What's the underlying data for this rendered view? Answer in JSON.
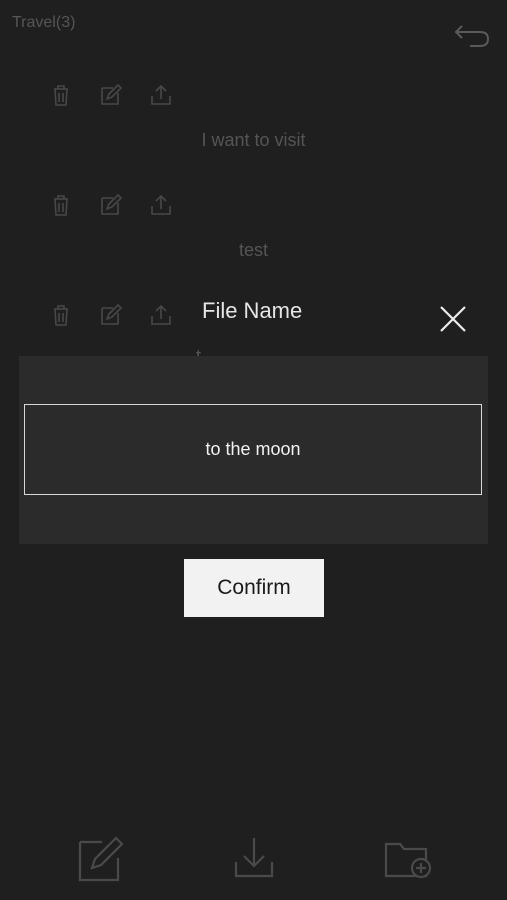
{
  "page": {
    "title": "Travel(3)",
    "icons": {
      "back": "back-arrow-icon",
      "delete": "trash-icon",
      "edit": "edit-icon",
      "share": "share-icon"
    },
    "rows": [
      {
        "text": "I want to visit"
      },
      {
        "text": "test"
      },
      {
        "text": "t..."
      }
    ]
  },
  "dialog": {
    "title": "File Name",
    "close_icon": "close-icon",
    "field_value": "to the moon",
    "confirm_label": "Confirm"
  },
  "toolbar": {
    "icons": [
      "new-note-icon",
      "download-icon",
      "new-folder-icon"
    ]
  },
  "colors": {
    "background": "#1f1f1f",
    "panel": "#2b2b2b",
    "button": "#f2f2f2"
  }
}
